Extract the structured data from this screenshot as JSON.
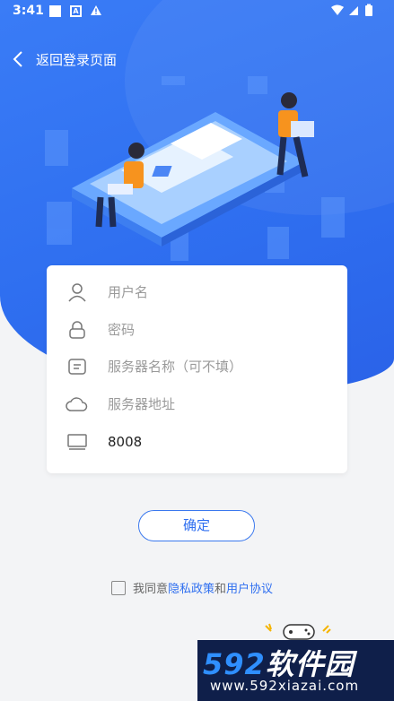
{
  "status_bar": {
    "time": "3:41",
    "notif_letter": "A"
  },
  "header": {
    "back_label": "返回登录页面"
  },
  "form": {
    "username_placeholder": "用户名",
    "password_placeholder": "密码",
    "server_name_placeholder": "服务器名称（可不填）",
    "server_address_placeholder": "服务器地址",
    "port_value": "8008"
  },
  "confirm_label": "确定",
  "agreement": {
    "prefix": "我同意",
    "privacy_link": "隐私政策",
    "and": "和",
    "user_link": "用户协议"
  },
  "watermark": {
    "big_digits": "592",
    "big_cn": "软件园",
    "url": "www.592xiazai.com"
  },
  "colors": {
    "primary": "#2f6ff0",
    "hero_bg": "#3a7cf6",
    "page_bg": "#f3f4f6"
  },
  "icons": [
    "chevron-left-icon",
    "user-icon",
    "lock-icon",
    "server-name-icon",
    "cloud-icon",
    "monitor-icon"
  ]
}
